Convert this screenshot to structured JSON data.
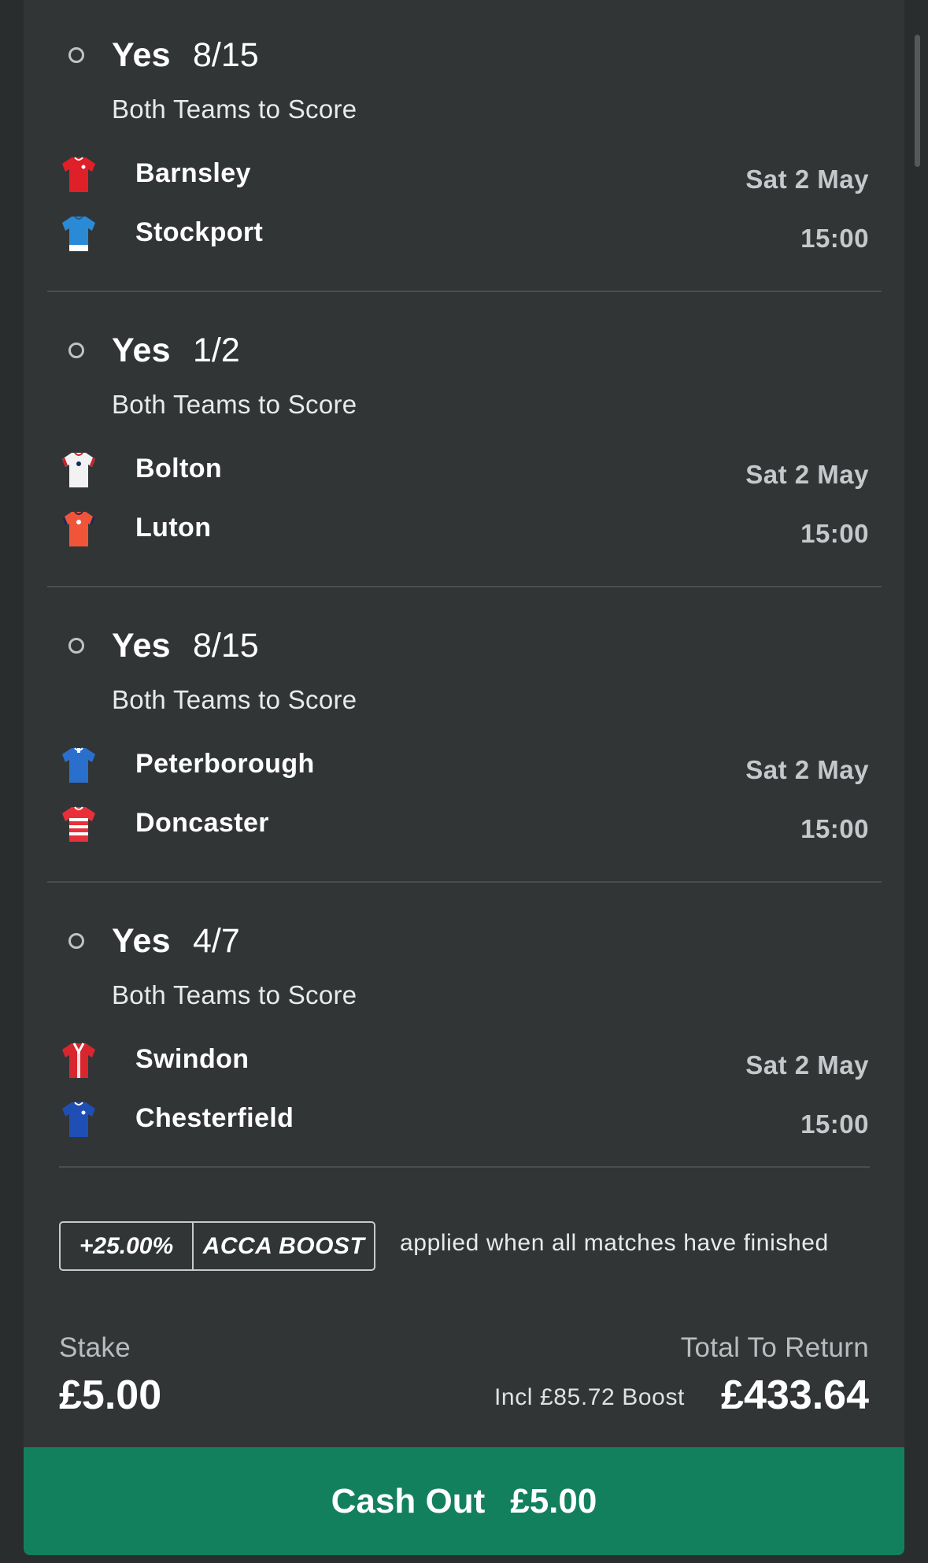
{
  "selections": [
    {
      "pick": "Yes",
      "odds": "8/15",
      "market": "Both Teams to Score",
      "home": {
        "name": "Barnsley",
        "shirt": "barnsley-shirt-icon"
      },
      "away": {
        "name": "Stockport",
        "shirt": "stockport-shirt-icon"
      },
      "date": "Sat 2 May",
      "time": "15:00"
    },
    {
      "pick": "Yes",
      "odds": "1/2",
      "market": "Both Teams to Score",
      "home": {
        "name": "Bolton",
        "shirt": "bolton-shirt-icon"
      },
      "away": {
        "name": "Luton",
        "shirt": "luton-shirt-icon"
      },
      "date": "Sat 2 May",
      "time": "15:00"
    },
    {
      "pick": "Yes",
      "odds": "8/15",
      "market": "Both Teams to Score",
      "home": {
        "name": "Peterborough",
        "shirt": "peterborough-shirt-icon"
      },
      "away": {
        "name": "Doncaster",
        "shirt": "doncaster-shirt-icon"
      },
      "date": "Sat 2 May",
      "time": "15:00"
    },
    {
      "pick": "Yes",
      "odds": "4/7",
      "market": "Both Teams to Score",
      "home": {
        "name": "Swindon",
        "shirt": "swindon-shirt-icon"
      },
      "away": {
        "name": "Chesterfield",
        "shirt": "chesterfield-shirt-icon"
      },
      "date": "Sat 2 May",
      "time": "15:00"
    }
  ],
  "boost": {
    "percent": "+25.00%",
    "label": "ACCA BOOST",
    "note": "applied when all matches have finished"
  },
  "stake": {
    "label": "Stake",
    "value": "£5.00"
  },
  "returns": {
    "label": "Total To Return",
    "boost_note": "Incl £85.72 Boost",
    "value": "£433.64"
  },
  "cashout": {
    "label": "Cash Out",
    "amount": "£5.00"
  },
  "colors": {
    "background": "#323536",
    "cashout": "#12805c",
    "divider": "#4a4e50"
  }
}
